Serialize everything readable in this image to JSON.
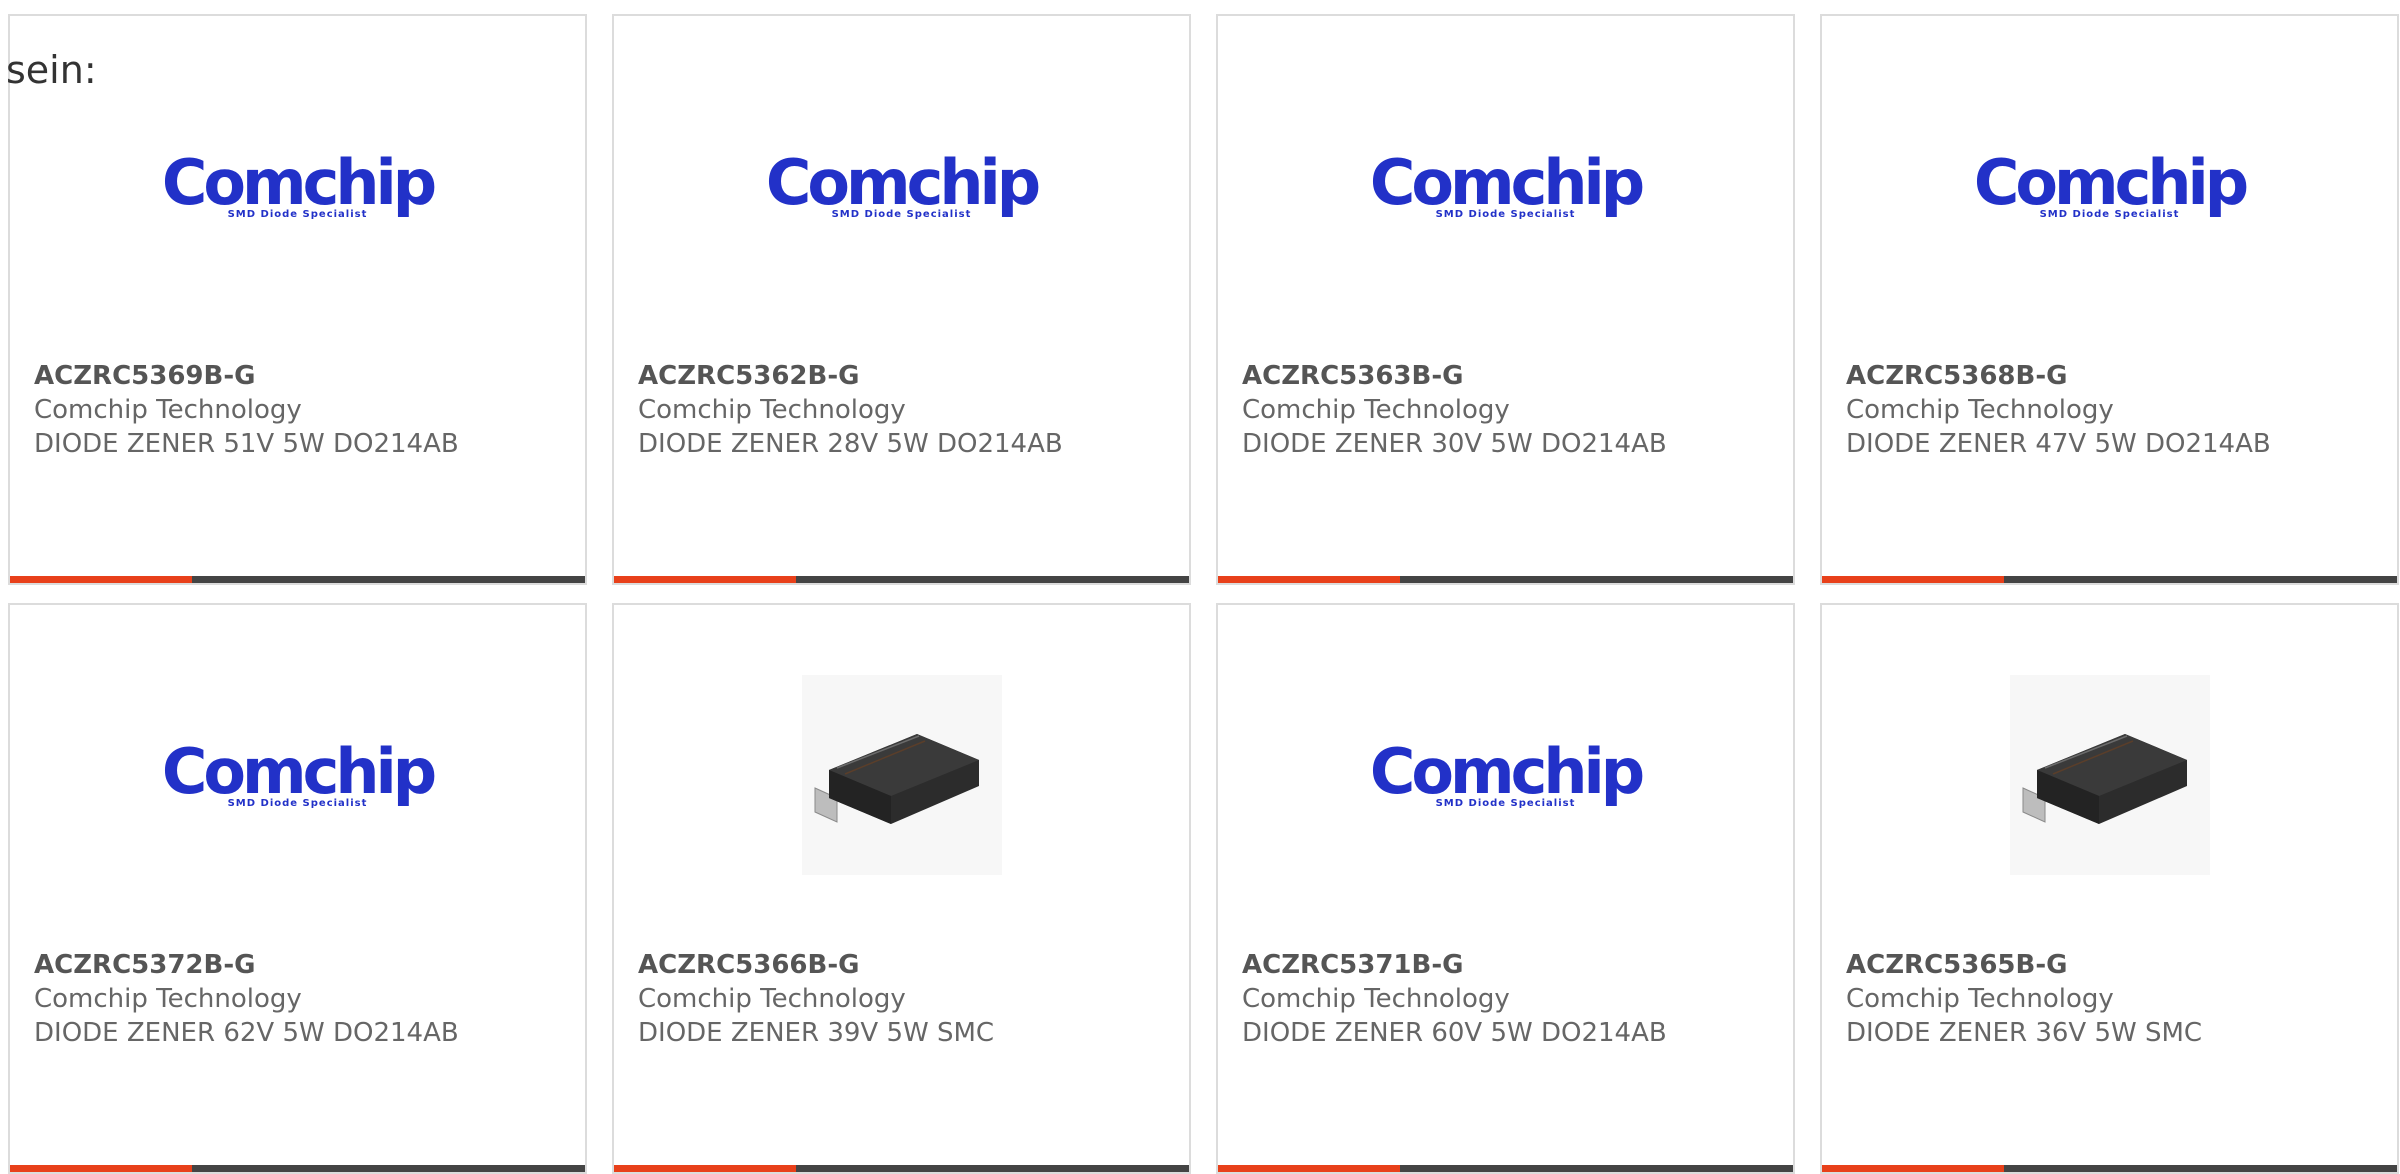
{
  "intro_text": "sein:",
  "colors": {
    "accent": "#e8401a",
    "bar": "#444444",
    "logo": "#2231c8",
    "border": "#dcdcdc"
  },
  "logo": {
    "word": "Comchip",
    "tagline": "SMD Diode Specialist"
  },
  "products": [
    {
      "part": "ACZRC5369B-G",
      "manufacturer": "Comchip Technology",
      "description": "DIODE ZENER 51V 5W DO214AB",
      "image": "comchip-logo"
    },
    {
      "part": "ACZRC5362B-G",
      "manufacturer": "Comchip Technology",
      "description": "DIODE ZENER 28V 5W DO214AB",
      "image": "comchip-logo"
    },
    {
      "part": "ACZRC5363B-G",
      "manufacturer": "Comchip Technology",
      "description": "DIODE ZENER 30V 5W DO214AB",
      "image": "comchip-logo"
    },
    {
      "part": "ACZRC5368B-G",
      "manufacturer": "Comchip Technology",
      "description": "DIODE ZENER 47V 5W DO214AB",
      "image": "comchip-logo"
    },
    {
      "part": "ACZRC5372B-G",
      "manufacturer": "Comchip Technology",
      "description": "DIODE ZENER 62V 5W DO214AB",
      "image": "comchip-logo"
    },
    {
      "part": "ACZRC5366B-G",
      "manufacturer": "Comchip Technology",
      "description": "DIODE ZENER 39V 5W SMC",
      "image": "smc-package"
    },
    {
      "part": "ACZRC5371B-G",
      "manufacturer": "Comchip Technology",
      "description": "DIODE ZENER 60V 5W DO214AB",
      "image": "comchip-logo"
    },
    {
      "part": "ACZRC5365B-G",
      "manufacturer": "Comchip Technology",
      "description": "DIODE ZENER 36V 5W SMC",
      "image": "smc-package"
    }
  ]
}
